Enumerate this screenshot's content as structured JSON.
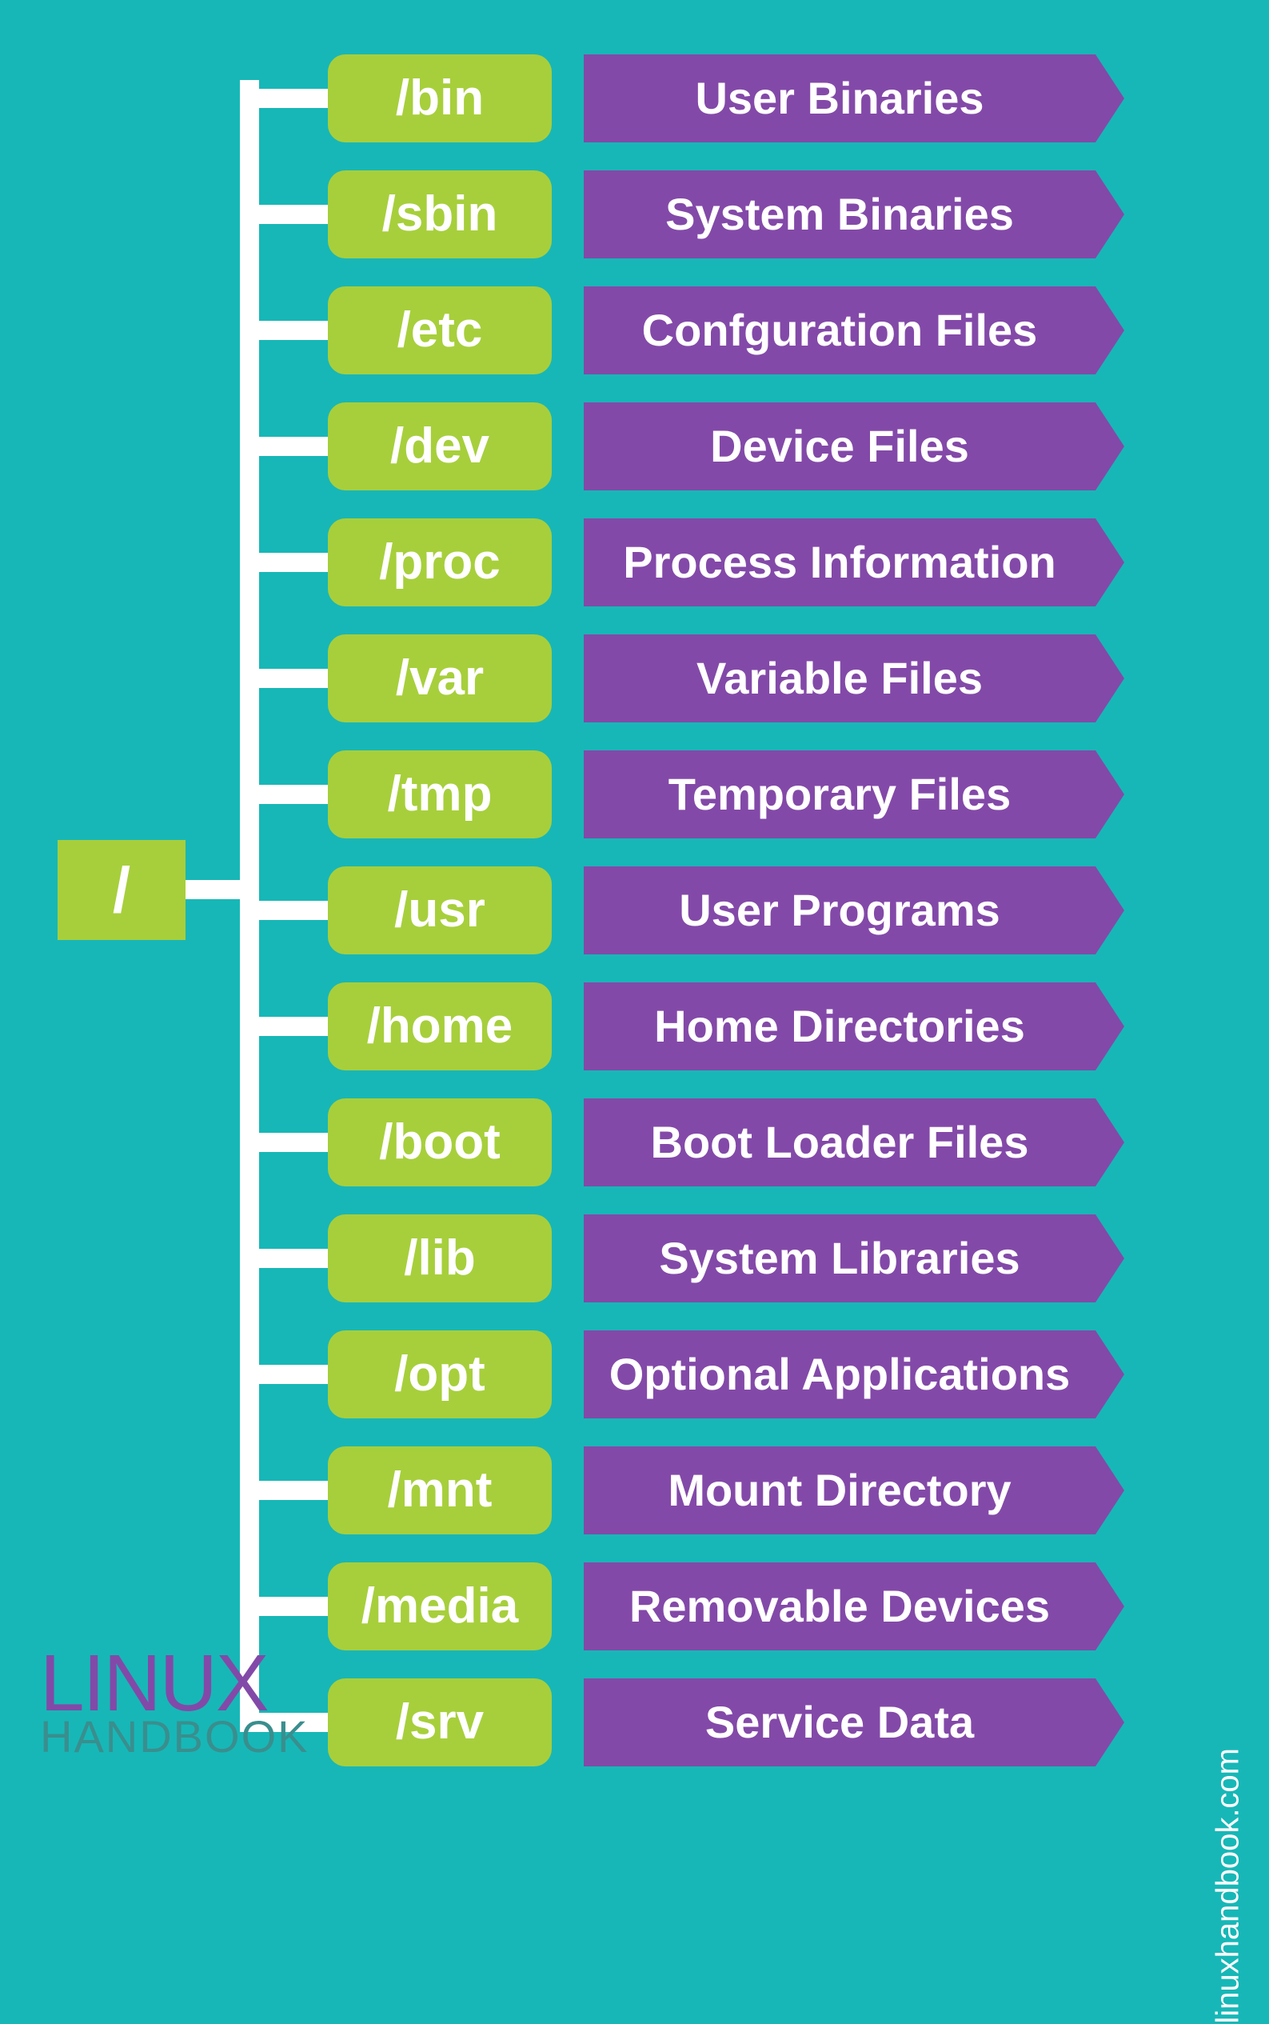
{
  "root": {
    "label": "/"
  },
  "directories": [
    {
      "path": "/bin",
      "desc": "User Binaries"
    },
    {
      "path": "/sbin",
      "desc": "System Binaries"
    },
    {
      "path": "/etc",
      "desc": "Confguration Files"
    },
    {
      "path": "/dev",
      "desc": "Device Files"
    },
    {
      "path": "/proc",
      "desc": "Process Information"
    },
    {
      "path": "/var",
      "desc": "Variable Files"
    },
    {
      "path": "/tmp",
      "desc": "Temporary Files"
    },
    {
      "path": "/usr",
      "desc": "User Programs"
    },
    {
      "path": "/home",
      "desc": "Home Directories"
    },
    {
      "path": "/boot",
      "desc": "Boot Loader Files"
    },
    {
      "path": "/lib",
      "desc": "System Libraries"
    },
    {
      "path": "/opt",
      "desc": "Optional Applications"
    },
    {
      "path": "/mnt",
      "desc": "Mount Directory"
    },
    {
      "path": "/media",
      "desc": "Removable Devices"
    },
    {
      "path": "/srv",
      "desc": "Service Data"
    }
  ],
  "brand": {
    "line1": "LINUX",
    "line2": "HANDBOOK"
  },
  "url": "linuxhandbook.com"
}
